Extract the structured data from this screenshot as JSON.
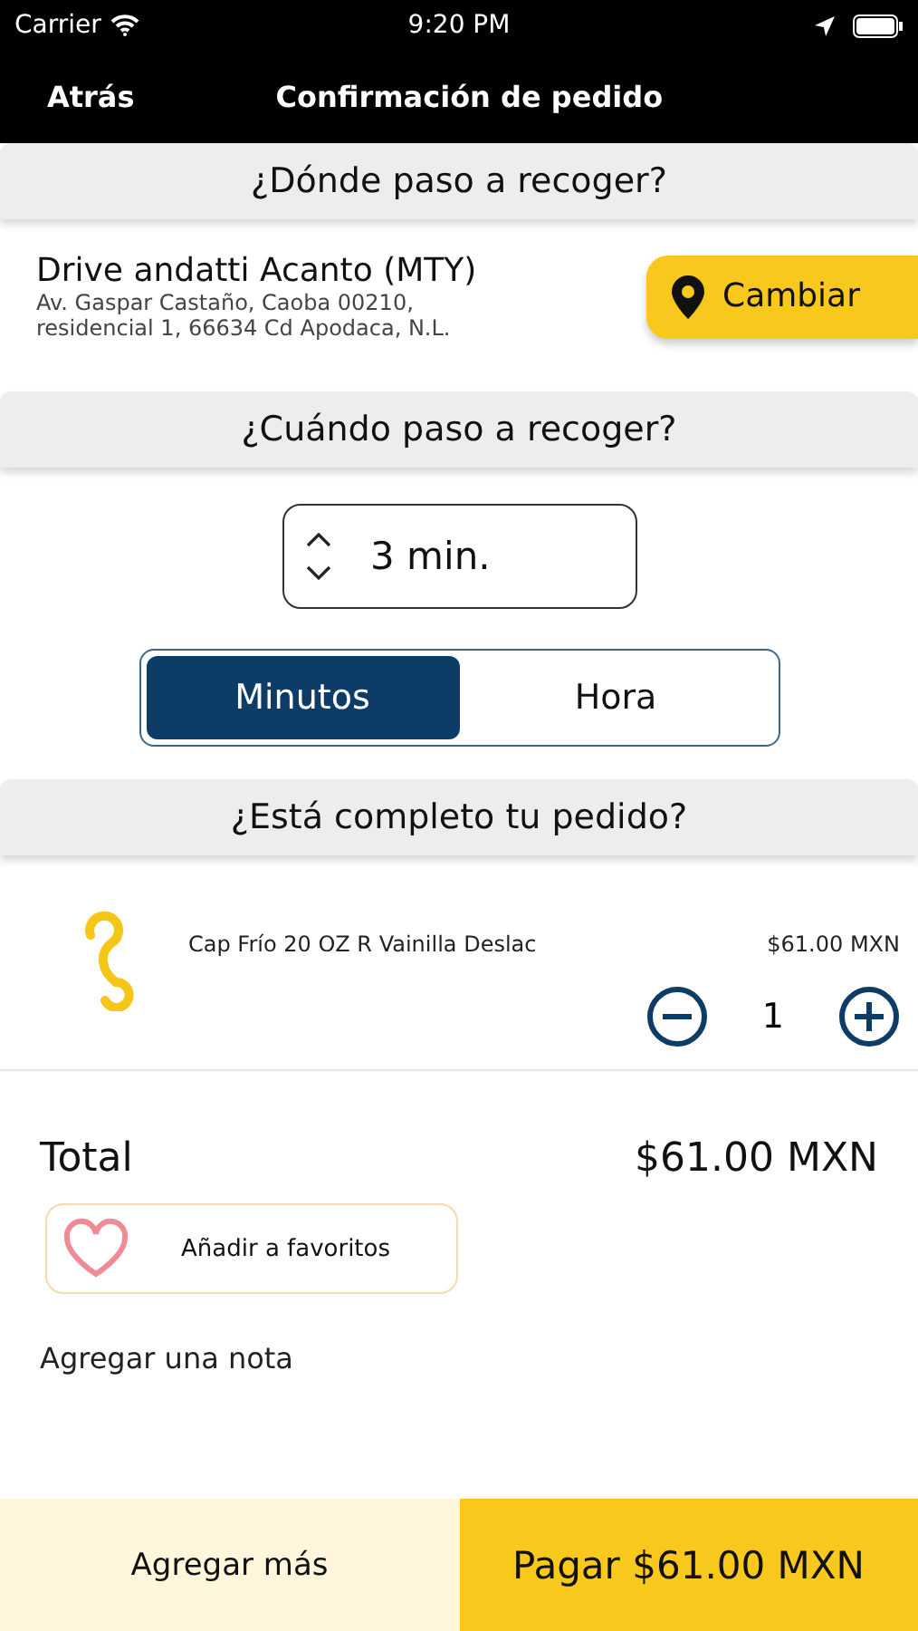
{
  "status_bar": {
    "carrier": "Carrier",
    "time": "9:20 PM"
  },
  "nav": {
    "back": "Atrás",
    "title": "Confirmación de pedido"
  },
  "pickup_place": {
    "header": "¿Dónde paso a recoger?",
    "name": "Drive andatti Acanto (MTY)",
    "address": "Av. Gaspar Castaño, Caoba 00210,\nresidencial 1, 66634 Cd Apodaca, N.L.",
    "change_button": "Cambiar"
  },
  "pickup_time": {
    "header": "¿Cuándo paso a recoger?",
    "value": "3 min.",
    "units": [
      {
        "label": "Minutos",
        "selected": true
      },
      {
        "label": "Hora",
        "selected": false
      }
    ]
  },
  "order": {
    "header": "¿Está completo tu pedido?",
    "items": [
      {
        "name": "Cap Frío 20 OZ R Vainilla Deslac",
        "price": "$61.00 MXN",
        "quantity": "1"
      }
    ],
    "total_label": "Total",
    "total": "$61.00 MXN",
    "favorite_button": "Añadir a favoritos",
    "note_label": "Agregar una nota"
  },
  "footer": {
    "add_more": "Agregar más",
    "pay": "Pagar $61.00 MXN"
  }
}
